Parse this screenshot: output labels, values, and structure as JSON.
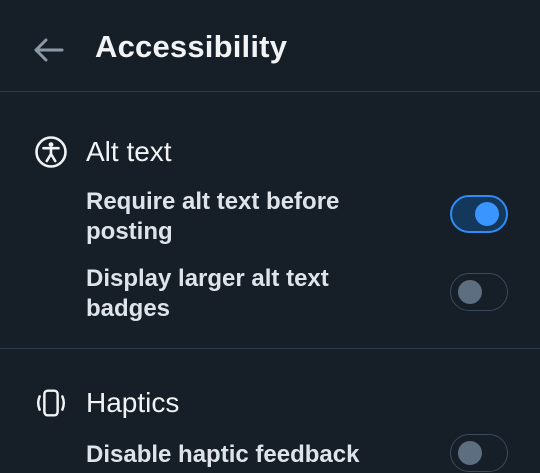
{
  "header": {
    "title": "Accessibility",
    "back_icon": "arrow-left-icon"
  },
  "sections": [
    {
      "title": "Alt text",
      "icon": "accessibility-person-icon",
      "settings": [
        {
          "label": "Require alt text before posting",
          "enabled": true
        },
        {
          "label": "Display larger alt text badges",
          "enabled": false
        }
      ]
    },
    {
      "title": "Haptics",
      "icon": "phone-vibrate-icon",
      "settings": [
        {
          "label": "Disable haptic feedback",
          "enabled": false
        }
      ]
    }
  ],
  "colors": {
    "background": "#161e27",
    "divider": "#2e3b49",
    "toggle_on": "#3a95ff",
    "toggle_off_knob": "#5c6e80"
  }
}
